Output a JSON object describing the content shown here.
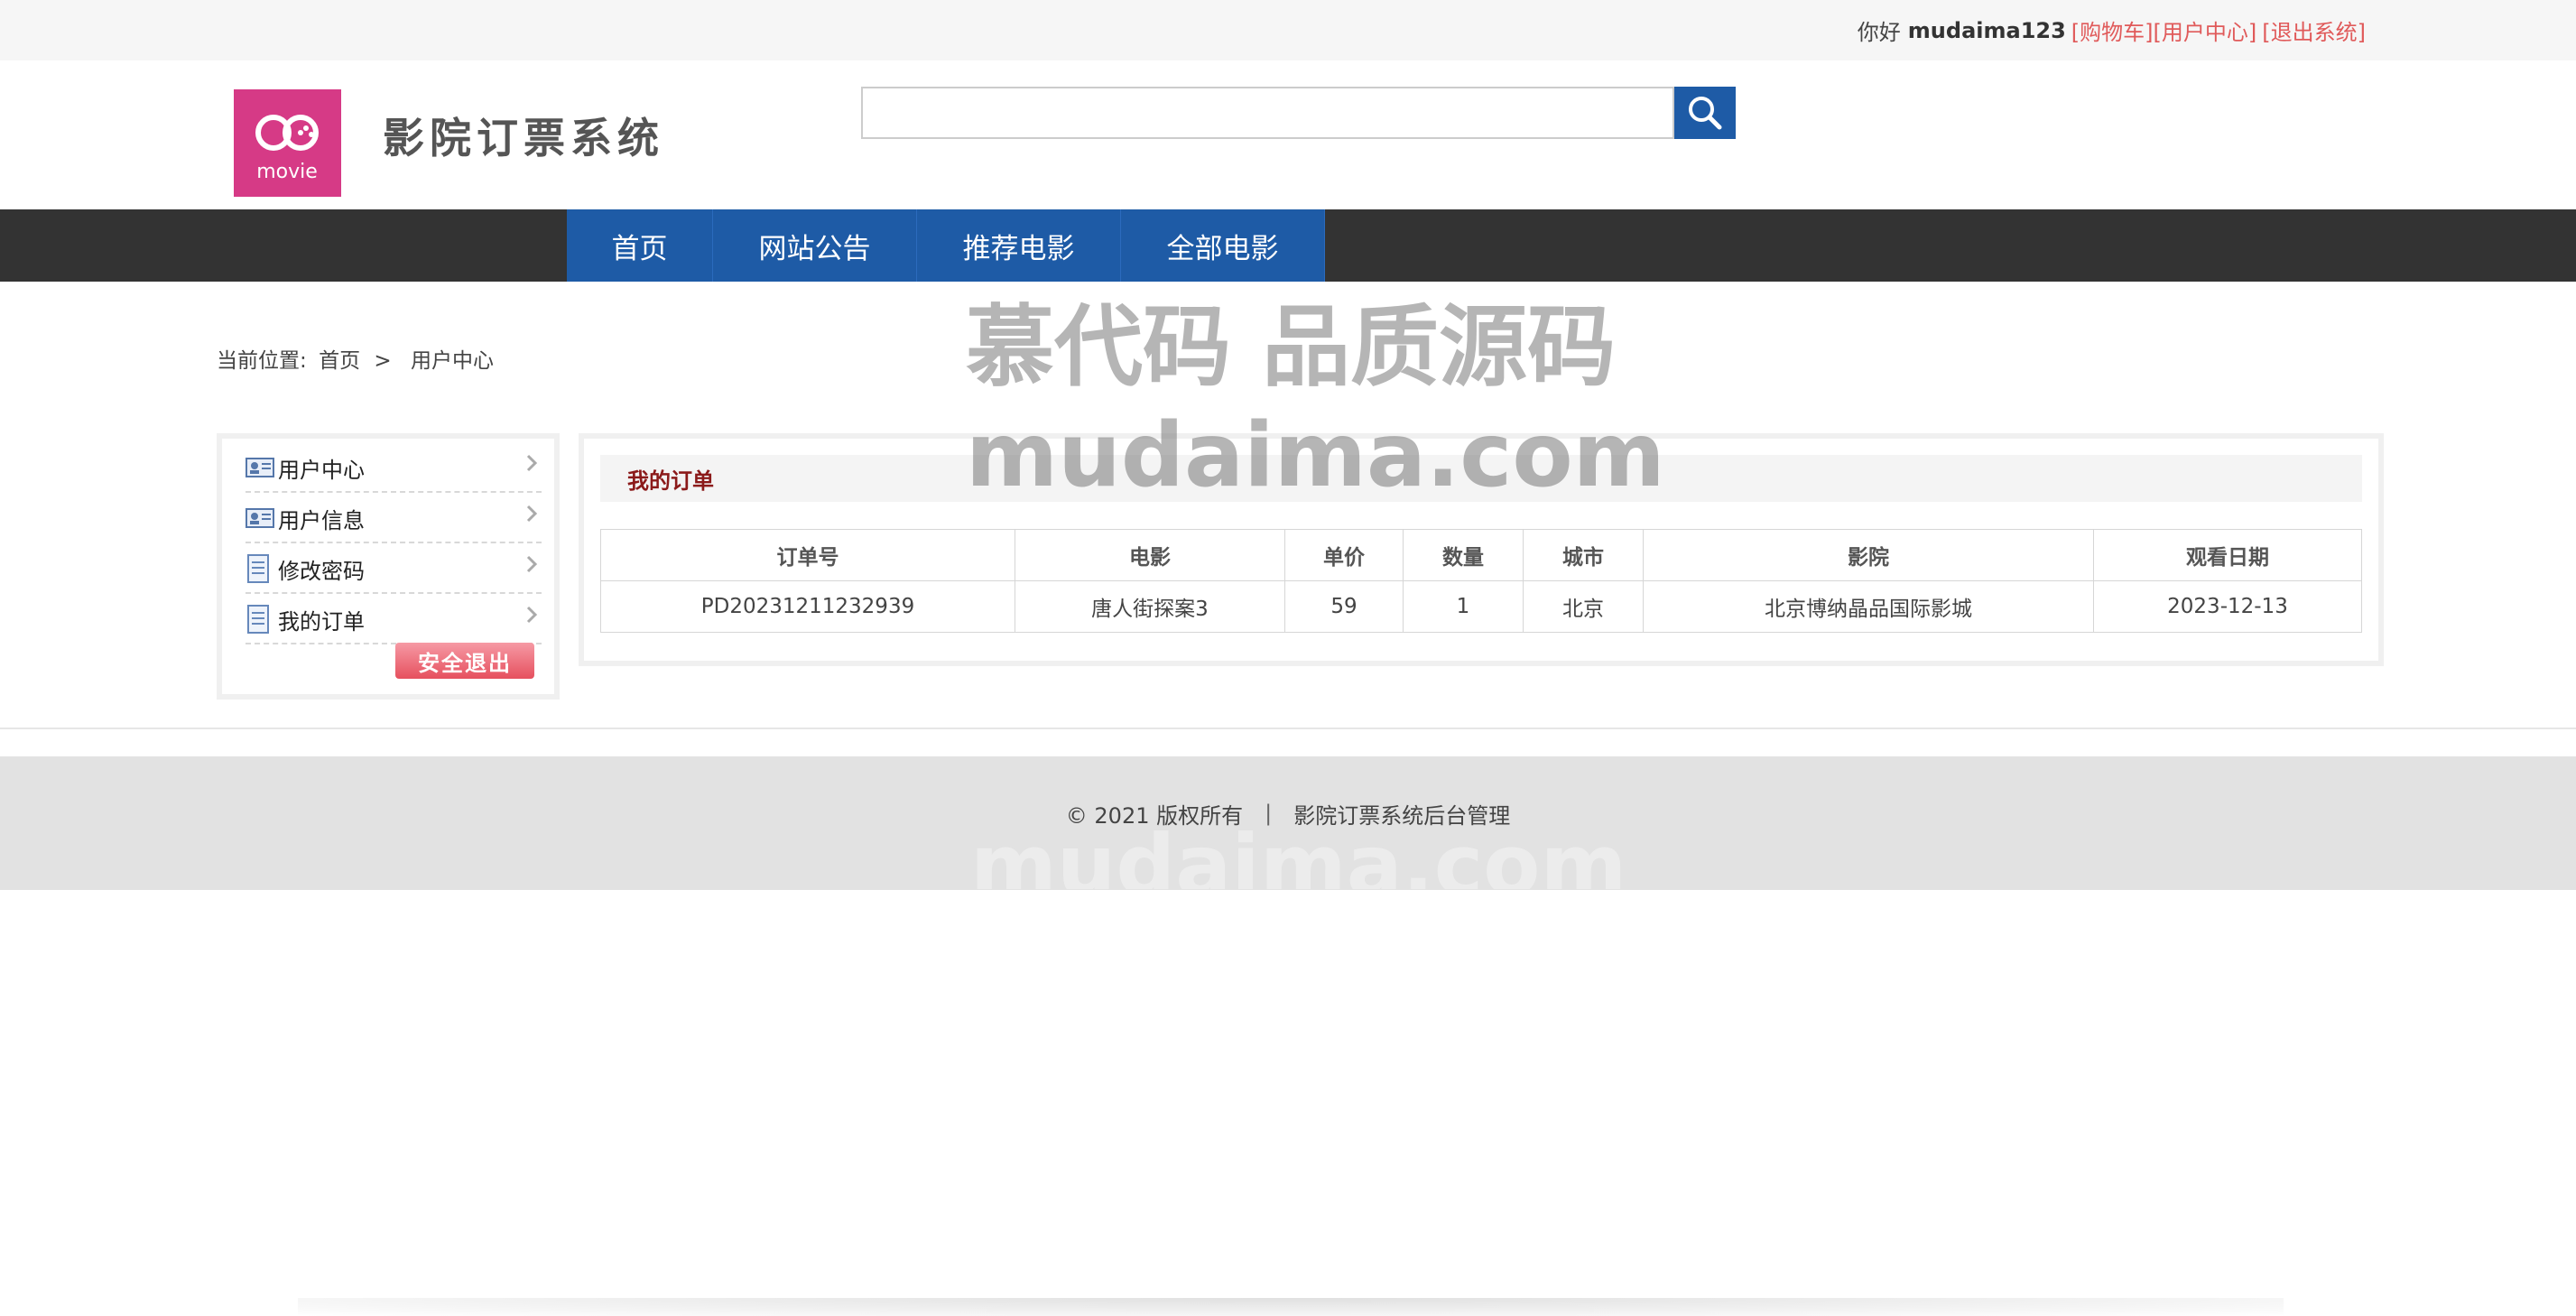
{
  "topbar": {
    "greeting": "你好",
    "username": "mudaima123",
    "cart_link": "[购物车]",
    "user_center_link": "[用户中心]",
    "logout_link": "[退出系统]"
  },
  "header": {
    "logo_text": "movie",
    "site_title": "影院订票系统",
    "search": {
      "value": "",
      "placeholder": ""
    }
  },
  "nav": {
    "items": [
      {
        "label": "首页"
      },
      {
        "label": "网站公告"
      },
      {
        "label": "推荐电影"
      },
      {
        "label": "全部电影"
      }
    ]
  },
  "breadcrumb": {
    "prefix": "当前位置:",
    "home": "首页",
    "separator": ">",
    "current": "用户中心"
  },
  "sidebar": {
    "items": [
      {
        "label": "用户中心",
        "icon": "id-card-icon"
      },
      {
        "label": "用户信息",
        "icon": "id-card-icon"
      },
      {
        "label": "修改密码",
        "icon": "document-icon"
      },
      {
        "label": "我的订单",
        "icon": "document-icon"
      }
    ],
    "logout_button": "安全退出"
  },
  "orders": {
    "title": "我的订单",
    "columns": [
      "订单号",
      "电影",
      "单价",
      "数量",
      "城市",
      "影院",
      "观看日期"
    ],
    "rows": [
      [
        "PD20231211232939",
        "唐人街探案3",
        "59",
        "1",
        "北京",
        "北京博纳晶品国际影城",
        "2023-12-13"
      ]
    ]
  },
  "footer": {
    "copyright": "© 2021 版权所有",
    "separator": "|",
    "admin_link": "影院订票系统后台管理"
  },
  "watermark": {
    "line1": "慕代码 品质源码",
    "line2": "mudaima.com",
    "footer_mark": "mudaima.com"
  },
  "colors": {
    "primary_blue": "#1e5ba6",
    "nav_dark": "#333333",
    "logo_pink": "#d63a86",
    "link_red": "#e05a5a",
    "title_dark_red": "#8b1a1a"
  }
}
